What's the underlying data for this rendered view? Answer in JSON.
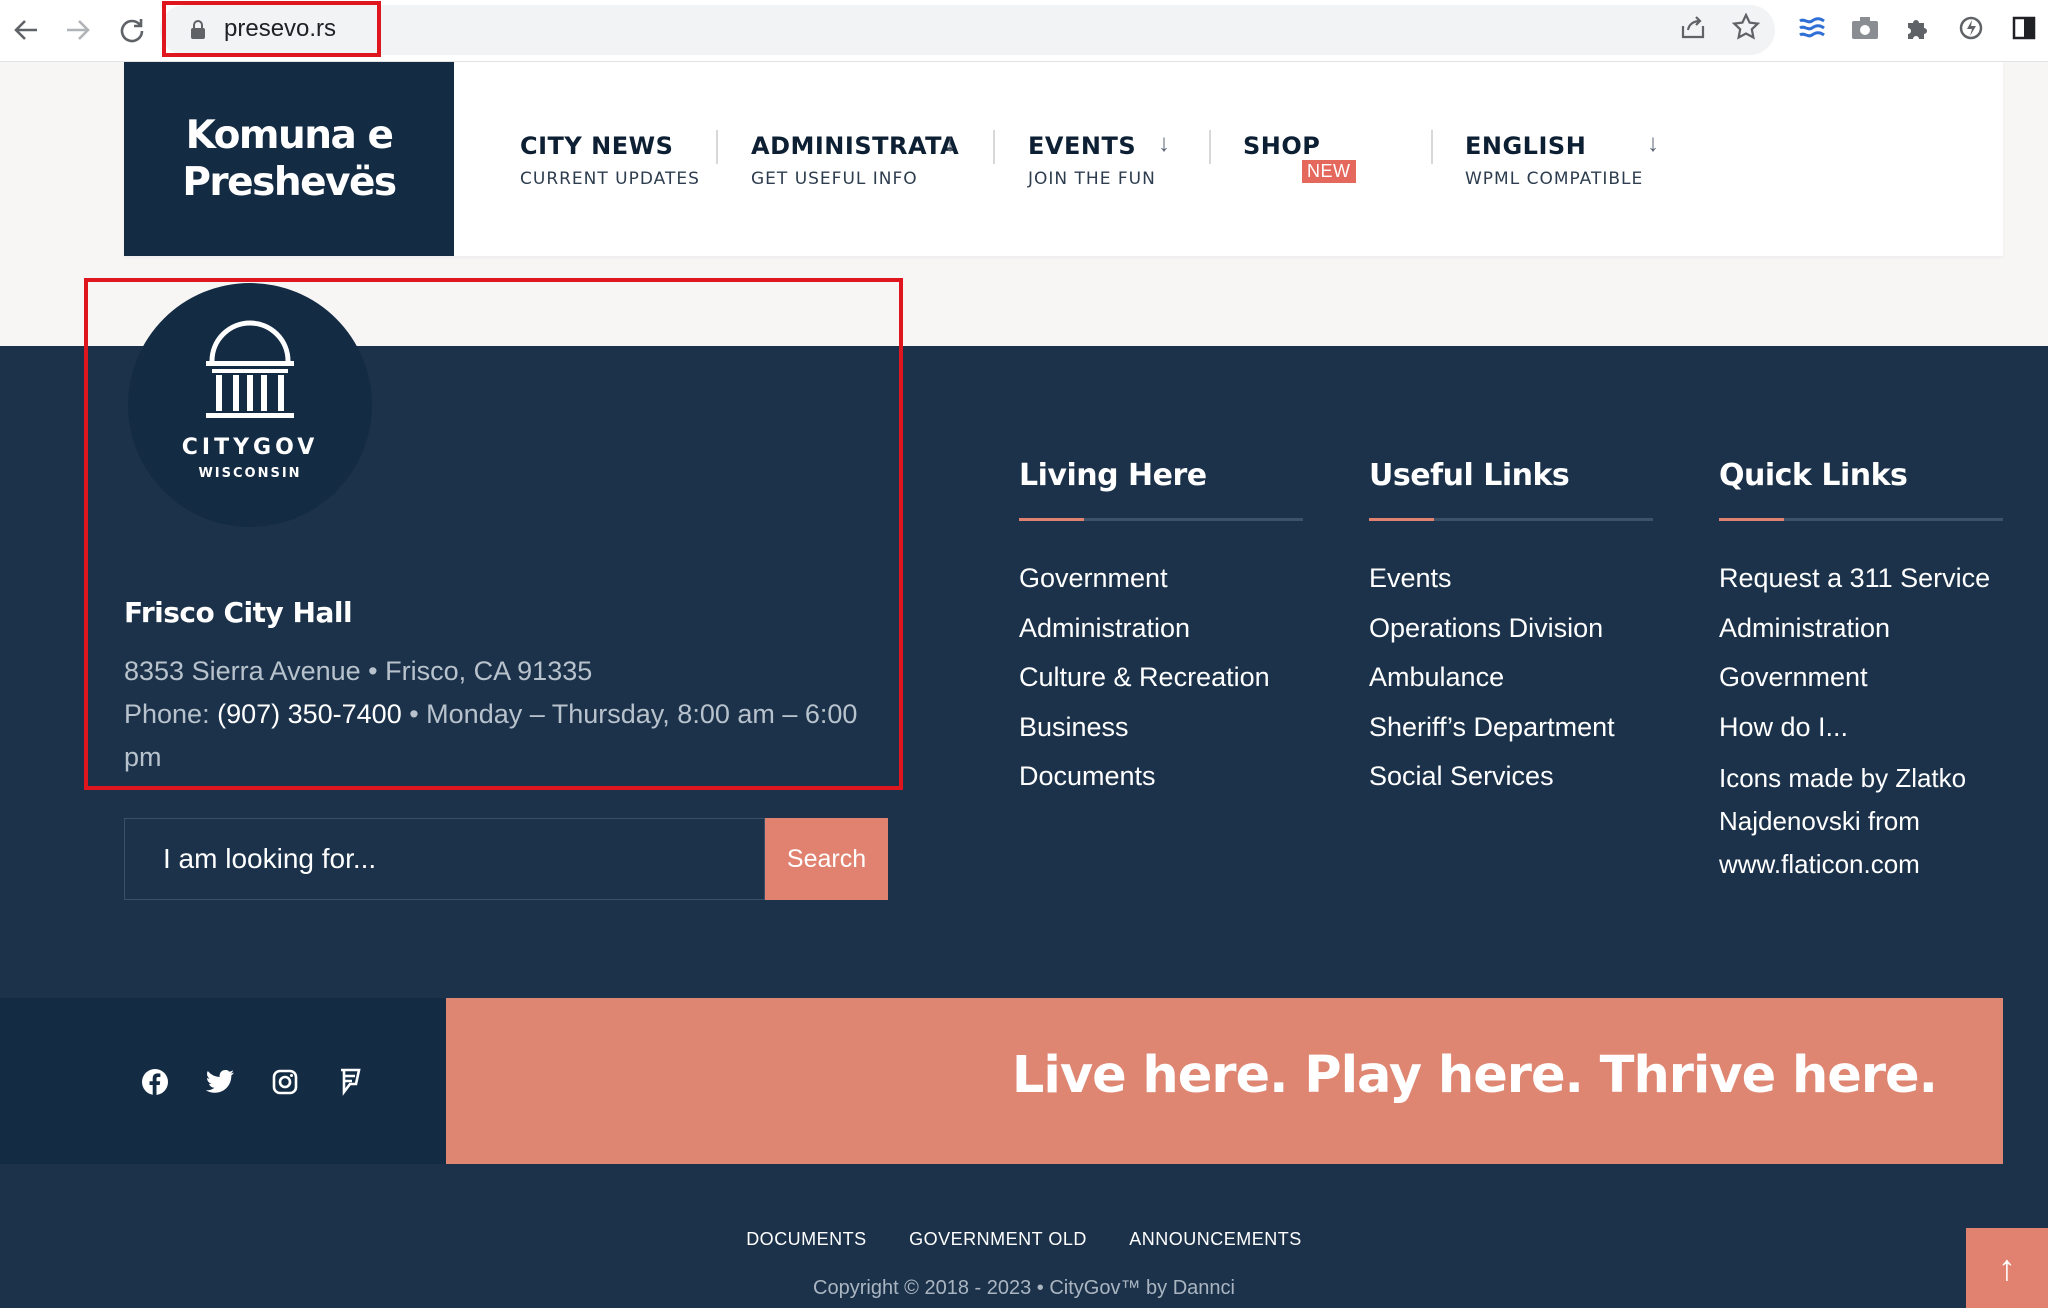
{
  "browser": {
    "url": "presevo.rs",
    "icons": [
      "back-arrow-icon",
      "forward-arrow-icon",
      "reload-icon",
      "lock-icon",
      "share-icon",
      "bookmark-star-icon",
      "layers-extension-icon",
      "camera-extension-icon",
      "puzzle-extension-icon",
      "speed-extension-icon",
      "sidebar-icon"
    ]
  },
  "header": {
    "logo_line1": "Komuna e",
    "logo_line2": "Preshevës",
    "nav": [
      {
        "title": "CITY NEWS",
        "subtitle": "CURRENT UPDATES"
      },
      {
        "title": "ADMINISTRATA",
        "subtitle": "GET USEFUL INFO",
        "arrow": "↓"
      },
      {
        "title": "EVENTS",
        "subtitle": "JOIN THE FUN",
        "arrow": "↓"
      },
      {
        "title": "SHOP",
        "badge": "NEW"
      },
      {
        "title": "ENGLISH",
        "subtitle": "WPML COMPATIBLE",
        "arrow": "↓"
      }
    ]
  },
  "footer": {
    "emblem": {
      "name": "CITYGOV",
      "state": "WISCONSIN"
    },
    "hall_title": "Frisco City Hall",
    "address": "8353 Sierra Avenue • Frisco, CA 91335",
    "phone_label": "Phone: ",
    "phone": "(907) 350-7400",
    "hours": " • Monday – Thursday, 8:00 am – 6:00 pm",
    "search": {
      "placeholder": "I am looking for...",
      "button": "Search"
    },
    "columns": [
      {
        "title": "Living Here",
        "items": [
          "Government",
          "Administration",
          "Culture & Recreation",
          "Business",
          "Documents"
        ]
      },
      {
        "title": "Useful Links",
        "items": [
          "Events",
          "Operations Division",
          "Ambulance",
          "Sheriff’s Department",
          "Social Services"
        ]
      },
      {
        "title": "Quick Links",
        "items": [
          "Request a 311 Service",
          "Administration",
          "Government",
          "How do I..."
        ]
      }
    ],
    "credits": {
      "prefix": "Icons made by ",
      "author": "Zlatko Najdenovski",
      "mid": " from ",
      "site": "www.flaticon.com"
    },
    "tagline": "Live here. Play here. Thrive here.",
    "social": [
      "facebook-icon",
      "twitter-icon",
      "instagram-icon",
      "foursquare-icon"
    ],
    "bottom_links": [
      "DOCUMENTS",
      "GOVERNMENT OLD",
      "ANNOUNCEMENTS"
    ],
    "copyright": "Copyright © 2018 - 2023 • CityGov™ by Dannci",
    "to_top": "↑"
  },
  "colors": {
    "navy": "#1b324a",
    "dark_navy": "#142b44",
    "accent": "#e0826f",
    "highlight": "#e0161e"
  }
}
